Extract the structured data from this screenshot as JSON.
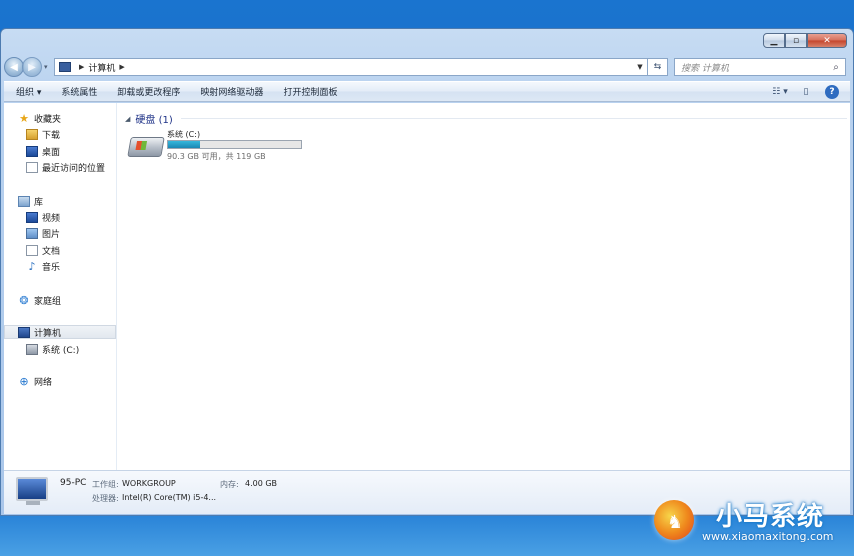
{
  "window": {
    "caption_buttons": {
      "minimize": "▁",
      "maximize": "▫",
      "close": "✕"
    }
  },
  "address_bar": {
    "path_item": "计算机",
    "search_placeholder": "搜索 计算机"
  },
  "toolbar": {
    "items": [
      "组织 ▾",
      "系统属性",
      "卸载或更改程序",
      "映射网络驱动器",
      "打开控制面板"
    ]
  },
  "nav_pane": {
    "favorites": {
      "label": "收藏夹",
      "items": [
        "下载",
        "桌面",
        "最近访问的位置"
      ]
    },
    "libraries": {
      "label": "库",
      "items": [
        "视频",
        "图片",
        "文档",
        "音乐"
      ]
    },
    "homegroup": {
      "label": "家庭组"
    },
    "computer": {
      "label": "计算机",
      "items": [
        "系统 (C:)"
      ]
    },
    "network": {
      "label": "网络"
    }
  },
  "content": {
    "group_title": "硬盘 (1)",
    "drive": {
      "name": "系统 (C:)",
      "free_text": "90.3 GB 可用，共 119 GB",
      "used_fraction": 0.24
    }
  },
  "details": {
    "pc_name": "95-PC",
    "workgroup_label": "工作组:",
    "workgroup_value": "WORKGROUP",
    "memory_label": "内存:",
    "memory_value": "4.00 GB",
    "cpu_label": "处理器:",
    "cpu_value": "Intel(R) Core(TM) i5-4..."
  },
  "watermark": {
    "title": "小马系统",
    "url": "www.xiaomaxitong.com"
  },
  "colors": {
    "desktop": "#1a6fc8",
    "usage_fill": "#1a96c6",
    "group_title": "#1e3287"
  }
}
